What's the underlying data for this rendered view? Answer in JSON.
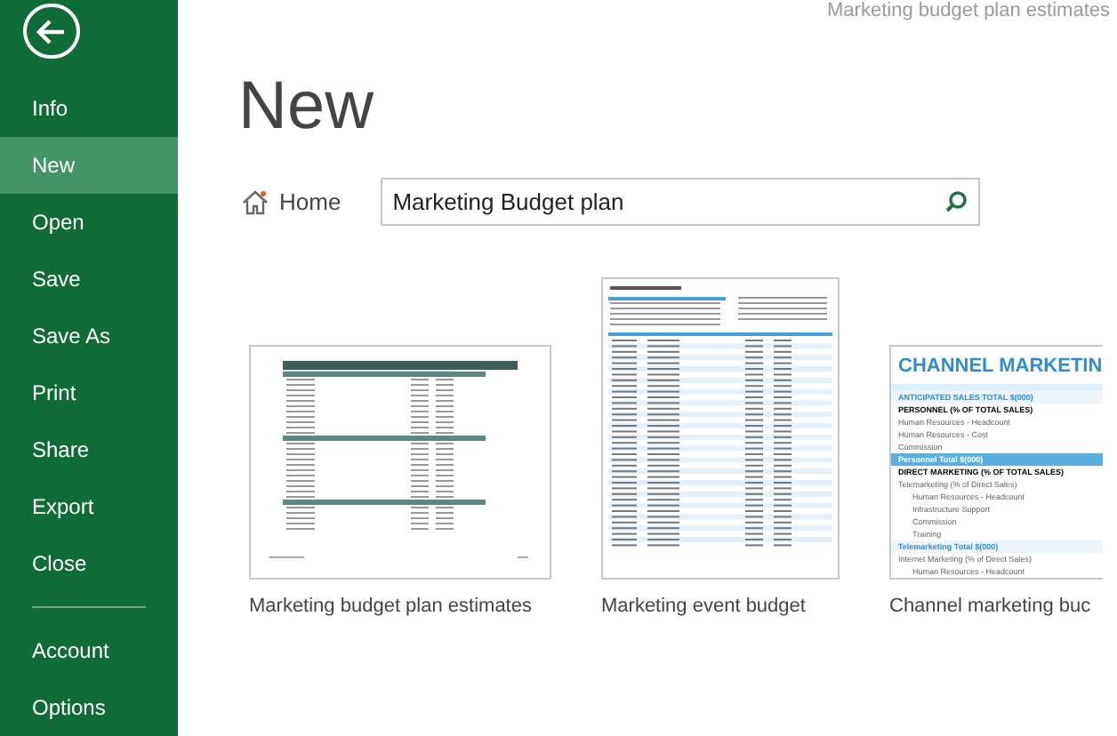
{
  "document_title": "Marketing budget plan estimates",
  "sidebar": {
    "items": [
      {
        "label": "Info",
        "selected": false
      },
      {
        "label": "New",
        "selected": true
      },
      {
        "label": "Open",
        "selected": false
      },
      {
        "label": "Save",
        "selected": false
      },
      {
        "label": "Save As",
        "selected": false
      },
      {
        "label": "Print",
        "selected": false
      },
      {
        "label": "Share",
        "selected": false
      },
      {
        "label": "Export",
        "selected": false
      },
      {
        "label": "Close",
        "selected": false
      }
    ],
    "bottom_items": [
      {
        "label": "Account",
        "selected": false
      },
      {
        "label": "Options",
        "selected": false
      }
    ]
  },
  "page_title": "New",
  "home_link": "Home",
  "search": {
    "value": "Marketing Budget plan"
  },
  "templates": [
    {
      "kind": "landscape",
      "label": "Marketing budget plan estimates"
    },
    {
      "kind": "portrait",
      "label": "Marketing event budget"
    },
    {
      "kind": "channel",
      "label": "Channel marketing buc",
      "heading": "CHANNEL MARKETIN",
      "lines": [
        {
          "text": "ANTICIPATED SALES TOTAL $(000)",
          "kind": "section"
        },
        {
          "text": "PERSONNEL (% OF TOTAL SALES)",
          "kind": "bold"
        },
        {
          "text": "Human Resources - Headcount",
          "kind": "plain"
        },
        {
          "text": "Human Resources - Cost",
          "kind": "plain"
        },
        {
          "text": "Commission",
          "kind": "plain"
        },
        {
          "text": "Personnel Total $(000)",
          "kind": "band"
        },
        {
          "text": "DIRECT MARKETING (% OF TOTAL SALES)",
          "kind": "bold"
        },
        {
          "text": "Telemarketing (% of Direct Sales)",
          "kind": "plain"
        },
        {
          "text": "Human Resources - Headcount",
          "kind": "indent"
        },
        {
          "text": "Infrastructure Support",
          "kind": "indent"
        },
        {
          "text": "Commission",
          "kind": "indent"
        },
        {
          "text": "Training",
          "kind": "indent"
        },
        {
          "text": "Telemarketing Total $(000)",
          "kind": "section"
        },
        {
          "text": "Internet Marketing (% of Direct Sales)",
          "kind": "plain"
        },
        {
          "text": "Human Resources - Headcount",
          "kind": "indent"
        }
      ]
    }
  ]
}
